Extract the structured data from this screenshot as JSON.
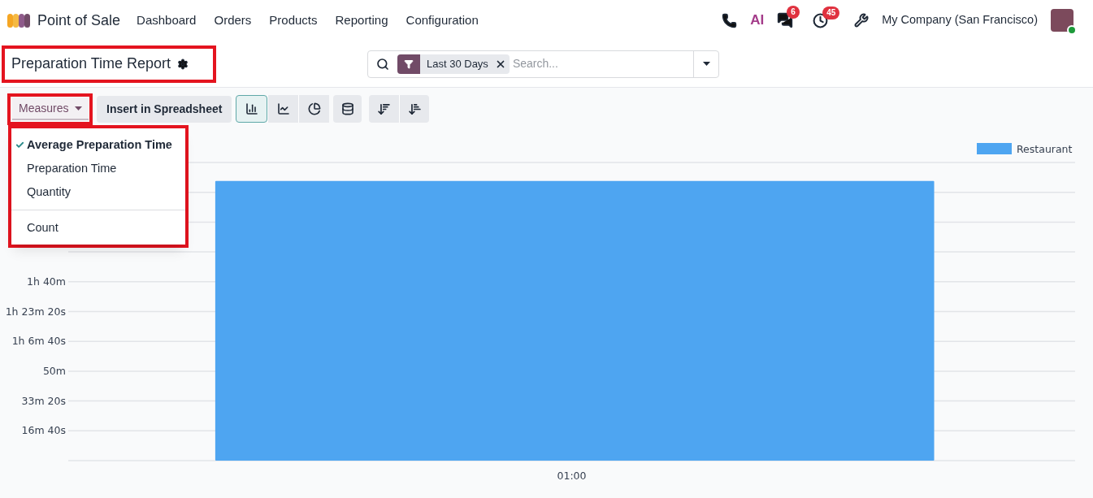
{
  "navbar": {
    "app_name": "Point of Sale",
    "menu": [
      "Dashboard",
      "Orders",
      "Products",
      "Reporting",
      "Configuration"
    ],
    "ai_logo": "AI",
    "messages_badge": "6",
    "activities_badge": "45",
    "company": "My Company (San Francisco)"
  },
  "control_panel": {
    "title": "Preparation Time Report",
    "search": {
      "facet": "Last 30 Days",
      "placeholder": "Search..."
    }
  },
  "toolbar": {
    "measures_label": "Measures",
    "insert_button": "Insert in Spreadsheet",
    "views": [
      {
        "kind": "bar",
        "selected": true
      },
      {
        "kind": "line",
        "selected": false
      },
      {
        "kind": "pie",
        "selected": false
      }
    ]
  },
  "measures_menu": [
    {
      "kind": "measure",
      "label": "Average Preparation Time",
      "selected": true
    },
    {
      "kind": "measure",
      "label": "Preparation Time",
      "selected": false
    },
    {
      "kind": "measure",
      "label": "Quantity",
      "selected": false
    },
    {
      "kind": "count",
      "label": "Count",
      "selected": false
    }
  ],
  "chart": {
    "legend": "Restaurant",
    "x_axis_labels": [
      "01:00"
    ],
    "y_axis_labels": [
      "1h 40m",
      "1h 23m 20s",
      "1h 6m 40s",
      "50m",
      "33m 20s",
      "16m 40s"
    ]
  }
}
